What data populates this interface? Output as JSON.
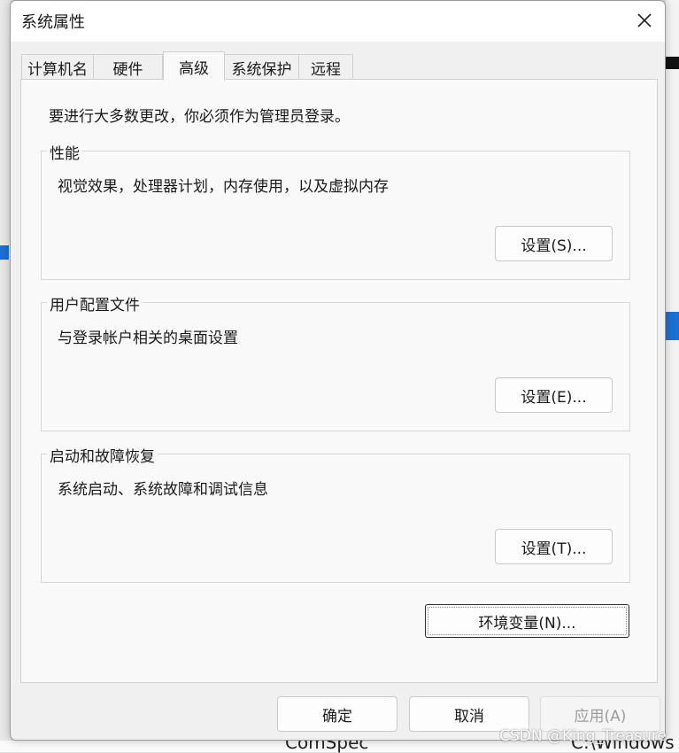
{
  "window": {
    "title": "系统属性"
  },
  "tabs": [
    {
      "label": "计算机名",
      "active": false
    },
    {
      "label": "硬件",
      "active": false
    },
    {
      "label": "高级",
      "active": true
    },
    {
      "label": "系统保护",
      "active": false
    },
    {
      "label": "远程",
      "active": false
    }
  ],
  "admin_note": "要进行大多数更改，你必须作为管理员登录。",
  "groups": {
    "performance": {
      "title": "性能",
      "description": "视觉效果，处理器计划，内存使用，以及虚拟内存",
      "button": "设置(S)...",
      "mnemonic": "S"
    },
    "user_profiles": {
      "title": "用户配置文件",
      "description": "与登录帐户相关的桌面设置",
      "button": "设置(E)...",
      "mnemonic": "E"
    },
    "startup_recovery": {
      "title": "启动和故障恢复",
      "description": "系统启动、系统故障和调试信息",
      "button": "设置(T)...",
      "mnemonic": "T"
    }
  },
  "env_button": {
    "label": "环境变量(N)...",
    "mnemonic": "N"
  },
  "footer": {
    "ok": "确定",
    "cancel": "取消",
    "apply": "应用(A)",
    "apply_enabled": false
  },
  "background": {
    "bottom_text_left": "ComSpec",
    "bottom_text_right": "C:\\Windows"
  },
  "watermark": "CSDN @King_Treasure",
  "colors": {
    "selection_blue": "#1d6fd1",
    "dialog_bg": "#f0f0f0",
    "panel_bg": "#f9f9f9",
    "disabled_text": "#9c9c9c"
  },
  "icons": {
    "close": "close-icon"
  }
}
